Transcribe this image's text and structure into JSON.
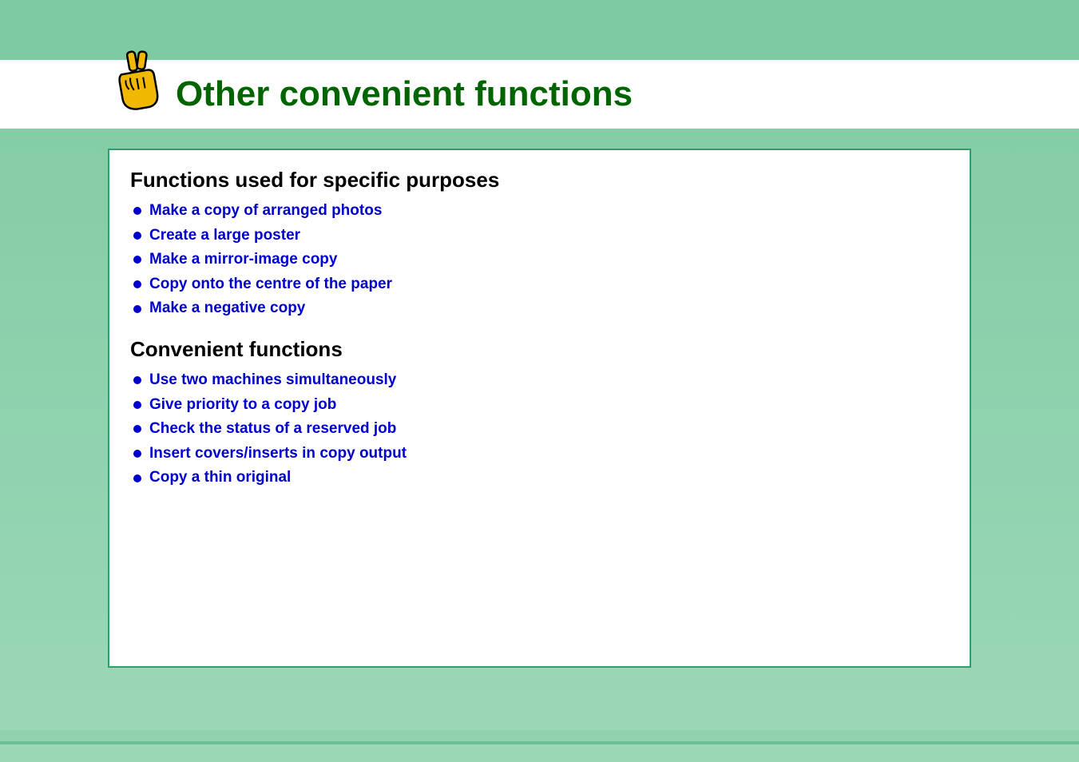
{
  "page": {
    "title": "Other convenient functions"
  },
  "sections": [
    {
      "heading": "Functions used for specific purposes",
      "items": [
        "Make a copy of arranged photos",
        "Create a large poster",
        "Make a mirror-image copy",
        "Copy onto the centre of the paper",
        "Make a negative copy"
      ]
    },
    {
      "heading": "Convenient functions",
      "items": [
        "Use two machines simultaneously",
        "Give priority to a copy job",
        "Check the status of a reserved job",
        "Insert covers/inserts in copy output",
        "Copy a thin original"
      ]
    }
  ]
}
